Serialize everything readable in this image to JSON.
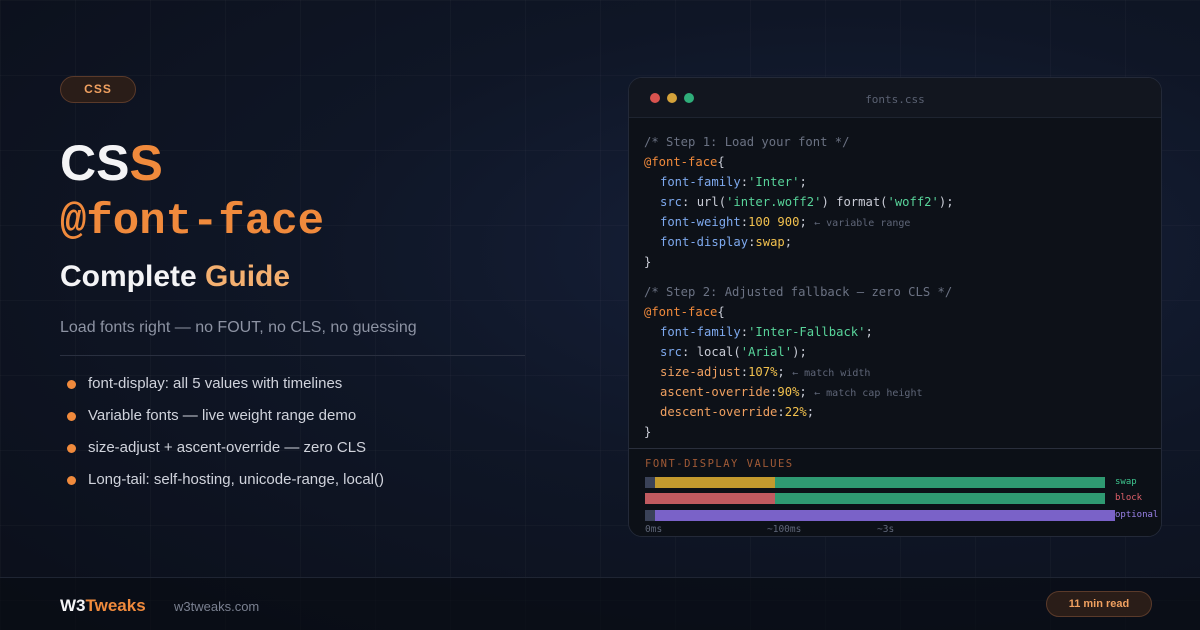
{
  "badge": "CSS",
  "title": {
    "part1": "CSS",
    "part2": "@font-face",
    "guide_a": "Complete ",
    "guide_b": "Guide"
  },
  "subtitle": "Load fonts right — no FOUT, no CLS, no guessing",
  "bullets": [
    "font-display: all 5 values with timelines",
    "Variable fonts — live weight range demo",
    "size-adjust + ascent-override — zero CLS",
    "Long-tail: self-hosting, unicode-range, local()"
  ],
  "code_window": {
    "filename": "fonts.css",
    "step1_comment": "/* Step 1: Load your font */",
    "step2_comment": "/* Step 2: Adjusted fallback — zero CLS */",
    "at_rule": "@font-face",
    "open_brace": "{",
    "close_brace": "}",
    "b1": {
      "family_prop": "font-family",
      "family_val": "'Inter'",
      "src_prop": "src",
      "src_url": "url(",
      "src_url_val": "'inter.woff2'",
      "src_format": ") format(",
      "src_format_val": "'woff2'",
      "src_end": ");",
      "weight_prop": "font-weight",
      "weight_val": "100 900",
      "weight_note": "← variable range",
      "display_prop": "font-display",
      "display_val": "swap"
    },
    "b2": {
      "family_prop": "font-family",
      "family_val": "'Inter-Fallback'",
      "src_prop": "src",
      "src_local": "local(",
      "src_local_val": "'Arial'",
      "src_end": ");",
      "size_prop": "size-adjust",
      "size_val": "107%",
      "size_note": "← match width",
      "ascent_prop": "ascent-override",
      "ascent_val": "90%",
      "ascent_note": "← match cap height",
      "descent_prop": "descent-override",
      "descent_val": "22%"
    }
  },
  "font_display": {
    "title": "FONT-DISPLAY VALUES",
    "labels": [
      "swap",
      "block",
      "optional"
    ],
    "ticks": [
      "0ms",
      "~100ms",
      "~3s"
    ]
  },
  "footer": {
    "brand_a": "W3",
    "brand_b": "Tweaks",
    "site": "w3tweaks.com",
    "read_time": "11 min read"
  },
  "colors": {
    "accent": "#f08a3c",
    "background": "#0f1626",
    "swap_bar": "#2f9a72",
    "block_bar": "#c05a60",
    "optional_bar": "#7a62c8",
    "wait_bar": "#c39a2e"
  }
}
